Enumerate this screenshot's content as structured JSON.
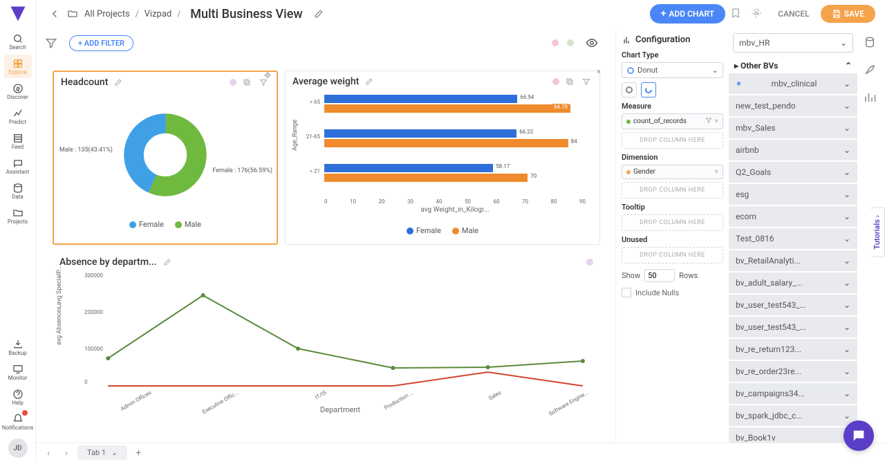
{
  "nav": {
    "items": [
      "Search",
      "Explore",
      "Discover",
      "Predict",
      "Feed",
      "Assistant",
      "Data",
      "Projects"
    ],
    "bottom": [
      "Backup",
      "Monitor",
      "Help",
      "Notifications"
    ],
    "user_initials": "JD"
  },
  "topbar": {
    "crumb1": "All Projects",
    "crumb2": "Vizpad",
    "title": "Multi Business View",
    "add_chart": "ADD CHART",
    "cancel": "CANCEL",
    "save": "SAVE"
  },
  "filter": {
    "add": "+ ADD FILTER"
  },
  "tabs": {
    "tab1": "Tab 1"
  },
  "cards": {
    "headcount": {
      "title": "Headcount"
    },
    "avgweight": {
      "title": "Average weight"
    },
    "absence": {
      "title": "Absence by departm..."
    }
  },
  "config": {
    "head": "Configuration",
    "chart_type_lbl": "Chart Type",
    "chart_type_val": "Donut",
    "measure_lbl": "Measure",
    "measure_pill": "count_of_records",
    "dimension_lbl": "Dimension",
    "dimension_pill": "Gender",
    "tooltip_lbl": "Tooltip",
    "unused_lbl": "Unused",
    "drop": "DROP COLUMN HERE",
    "show_lbl": "Show",
    "show_val": "50",
    "rows_lbl": "Rows",
    "nulls_lbl": "Include Nulls"
  },
  "bv": {
    "selected": "mbv_HR",
    "head": "Other BVs",
    "items": [
      "mbv_clinical",
      "new_test_pendo",
      "mbv_Sales",
      "airbnb",
      "Q2_Goals",
      "esg",
      "ecom",
      "Test_0816",
      "bv_RetailAnalyti...",
      "bv_adult_salary_...",
      "bv_user_test543_...",
      "bv_user_test543_...",
      "bv_re_return123...",
      "bv_re_order23re...",
      "bv_campaigns34...",
      "bv_spark_jdbc_c...",
      "bv_Book1v"
    ]
  },
  "tutorials": "Tutorials ›",
  "legends": {
    "female": "Female",
    "male": "Male"
  },
  "chart_data": [
    {
      "id": "headcount",
      "type": "pie",
      "title": "Headcount",
      "series": [
        {
          "name": "Female",
          "value": 176,
          "pct": 56.59,
          "color": "#6fb93f",
          "label": "Female : 176(56.59%)"
        },
        {
          "name": "Male",
          "value": 135,
          "pct": 43.41,
          "color": "#3fa0e6",
          "label": "Male : 135(43.41%)"
        }
      ]
    },
    {
      "id": "avgweight",
      "type": "bar",
      "title": "Average weight",
      "orientation": "horizontal",
      "xlabel": "avg Weight_in_Kilogr...",
      "ylabel": "Age_Range",
      "xlim": [
        0,
        90
      ],
      "xticks": [
        0,
        10,
        20,
        30,
        40,
        50,
        60,
        70,
        80,
        90
      ],
      "categories": [
        "> 65",
        "21-65",
        "< 21"
      ],
      "series": [
        {
          "name": "Female",
          "color": "#2e6fd9",
          "values": [
            66.54,
            66.22,
            58.17
          ]
        },
        {
          "name": "Male",
          "color": "#f08a2c",
          "values": [
            84.78,
            84,
            70
          ]
        }
      ]
    },
    {
      "id": "absence",
      "type": "line",
      "title": "Absence by department",
      "xlabel": "Department",
      "ylabel": "avg Absences,avg SpecialP...",
      "ylim": [
        0,
        300000
      ],
      "yticks": [
        0,
        100000,
        200000,
        300000
      ],
      "categories": [
        "Admin Offices",
        "Executive Offic...",
        "IT/IS",
        "Production ...",
        "Sales",
        "Software Engine..."
      ],
      "series": [
        {
          "name": "avg SpecialP",
          "color": "#5a8a3a",
          "values": [
            80000,
            250000,
            105000,
            52000,
            55000,
            72000
          ]
        },
        {
          "name": "avg Absences",
          "color": "#d6442f",
          "values": [
            2000,
            2000,
            2000,
            2000,
            40000,
            2000
          ]
        }
      ]
    }
  ]
}
